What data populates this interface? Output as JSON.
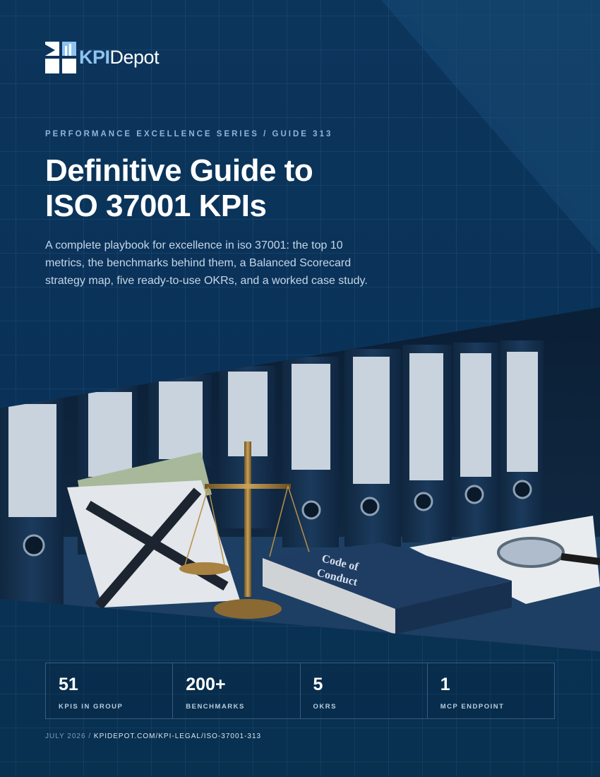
{
  "brand": {
    "kpi": "KPI",
    "depot": "Depot"
  },
  "eyebrow": "PERFORMANCE EXCELLENCE SERIES / GUIDE 313",
  "title_line1": "Definitive Guide to",
  "title_line2": "ISO 37001 KPIs",
  "lead": "A complete playbook for excellence in iso 37001: the top 10 metrics, the benchmarks behind them, a Balanced Scorecard strategy map, five ready-to-use OKRs, and a worked case study.",
  "photo": {
    "book_title_1": "Code of",
    "book_title_2": "Conduct"
  },
  "stats": [
    {
      "value": "51",
      "label": "KPIS IN GROUP"
    },
    {
      "value": "200+",
      "label": "BENCHMARKS"
    },
    {
      "value": "5",
      "label": "OKRS"
    },
    {
      "value": "1",
      "label": "MCP ENDPOINT"
    }
  ],
  "footer": {
    "date": "JULY 2026",
    "separator": " / ",
    "url": "KPIDEPOT.COM/KPI-LEGAL/ISO-37001-313"
  },
  "colors": {
    "background": "#0b3358",
    "accent": "#8ec4ef",
    "text": "#ffffff"
  }
}
